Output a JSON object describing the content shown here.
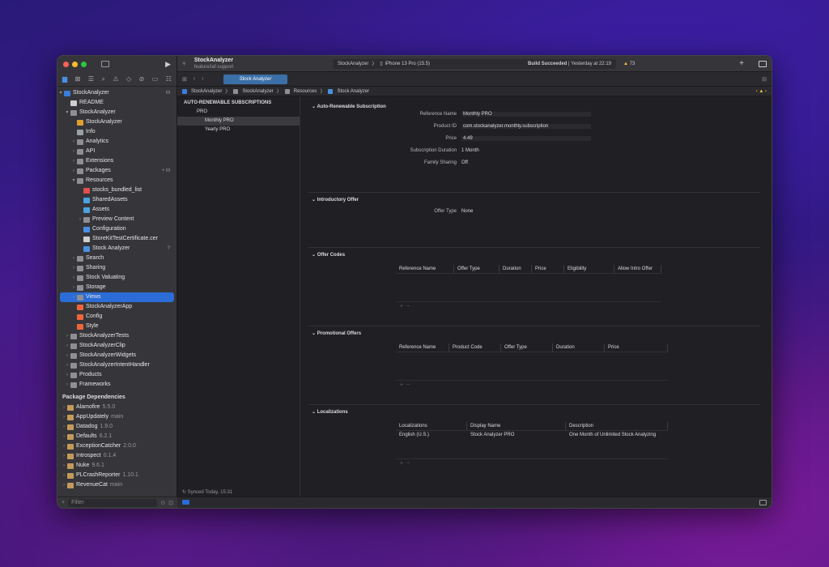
{
  "window": {
    "project_name": "StockAnalyzer",
    "branch": "feature/iaf-support",
    "scheme": "StockAnalyzer",
    "device": "iPhone 13 Pro (15.5)",
    "build_status": "Build Succeeded",
    "build_time": "Yesterday at 22:19",
    "warnings": "73"
  },
  "tab": {
    "label": "Stock Analyzer"
  },
  "pathbar": [
    "StockAnalyzer",
    "StockAnalyzer",
    "Resources",
    "Stock Analyzer"
  ],
  "sidebar": {
    "root": "StockAnalyzer",
    "root_badge": "M",
    "items": [
      {
        "label": "README",
        "depth": 1,
        "icon": "doc",
        "chev": ""
      },
      {
        "label": "StockAnalyzer",
        "depth": 1,
        "icon": "folder",
        "chev": "v"
      },
      {
        "label": "StockAnalyzer",
        "depth": 2,
        "icon": "entitlement",
        "chev": ""
      },
      {
        "label": "Info",
        "depth": 2,
        "icon": "plist",
        "chev": ""
      },
      {
        "label": "Analytics",
        "depth": 2,
        "icon": "folder",
        "chev": ">"
      },
      {
        "label": "API",
        "depth": 2,
        "icon": "folder",
        "chev": ">"
      },
      {
        "label": "Extensions",
        "depth": 2,
        "icon": "folder",
        "chev": ">"
      },
      {
        "label": "Packages",
        "depth": 2,
        "icon": "folder",
        "chev": ">",
        "badge": "+ M"
      },
      {
        "label": "Resources",
        "depth": 2,
        "icon": "folder",
        "chev": "v"
      },
      {
        "label": "stocks_bundled_list",
        "depth": 3,
        "icon": "json",
        "chev": ""
      },
      {
        "label": "SharedAssets",
        "depth": 3,
        "icon": "assets",
        "chev": ""
      },
      {
        "label": "Assets",
        "depth": 3,
        "icon": "assets",
        "chev": ""
      },
      {
        "label": "Preview Content",
        "depth": 3,
        "icon": "folder",
        "chev": ">"
      },
      {
        "label": "Configuration",
        "depth": 3,
        "icon": "storekit",
        "chev": ""
      },
      {
        "label": "StoreKitTestCertificate.cer",
        "depth": 3,
        "icon": "doc",
        "chev": ""
      },
      {
        "label": "Stock Analyzer",
        "depth": 3,
        "icon": "storekit",
        "chev": "",
        "badge": "?"
      },
      {
        "label": "Search",
        "depth": 2,
        "icon": "folder",
        "chev": ">"
      },
      {
        "label": "Sharing",
        "depth": 2,
        "icon": "folder",
        "chev": ">"
      },
      {
        "label": "Stock Valuating",
        "depth": 2,
        "icon": "folder",
        "chev": ">"
      },
      {
        "label": "Storage",
        "depth": 2,
        "icon": "folder",
        "chev": ">"
      },
      {
        "label": "Views",
        "depth": 2,
        "icon": "folder",
        "chev": ">",
        "selected": true
      },
      {
        "label": "StockAnalyzerApp",
        "depth": 2,
        "icon": "swift",
        "chev": ""
      },
      {
        "label": "Config",
        "depth": 2,
        "icon": "swift",
        "chev": ""
      },
      {
        "label": "Style",
        "depth": 2,
        "icon": "swift",
        "chev": ""
      },
      {
        "label": "StockAnalyzerTests",
        "depth": 1,
        "icon": "folder",
        "chev": ">"
      },
      {
        "label": "StockAnalyzerClip",
        "depth": 1,
        "icon": "folder",
        "chev": ">"
      },
      {
        "label": "StockAnalyzerWidgets",
        "depth": 1,
        "icon": "folder",
        "chev": ">"
      },
      {
        "label": "StockAnalyzerIntentHandler",
        "depth": 1,
        "icon": "folder",
        "chev": ">"
      },
      {
        "label": "Products",
        "depth": 1,
        "icon": "folder",
        "chev": ">"
      },
      {
        "label": "Frameworks",
        "depth": 1,
        "icon": "folder",
        "chev": ">"
      }
    ],
    "packages_heading": "Package Dependencies",
    "packages": [
      {
        "name": "Alamofire",
        "version": "5.5.0"
      },
      {
        "name": "AppUpdately",
        "version": "main"
      },
      {
        "name": "Datadog",
        "version": "1.9.0"
      },
      {
        "name": "Defaults",
        "version": "6.2.1"
      },
      {
        "name": "ExceptionCatcher",
        "version": "2.0.0"
      },
      {
        "name": "Introspect",
        "version": "0.1.4"
      },
      {
        "name": "Nuke",
        "version": "9.6.1"
      },
      {
        "name": "PLCrashReporter",
        "version": "1.10.1"
      },
      {
        "name": "RevenueCat",
        "version": "main"
      }
    ],
    "filter_placeholder": "Filter"
  },
  "subscriptions": {
    "heading": "AUTO-RENEWABLE SUBSCRIPTIONS",
    "group": "PRO",
    "items": [
      "Monthly PRO",
      "Yearly PRO"
    ],
    "synced": "Synced Today, 15:31"
  },
  "detail": {
    "auto_title": "Auto-Renewable Subscription",
    "fields": [
      {
        "key": "Reference Name",
        "value": "Monthly PRO"
      },
      {
        "key": "Product ID",
        "value": "com.stockanalyzer.monthly.subscription"
      },
      {
        "key": "Price",
        "value": "4.49"
      },
      {
        "key": "Subscription Duration",
        "value": "1 Month"
      },
      {
        "key": "Family Sharing",
        "value": "Off"
      }
    ],
    "intro_title": "Introductory Offer",
    "offer_type_key": "Offer Type",
    "offer_type_value": "None",
    "codes_title": "Offer Codes",
    "codes_columns": [
      "Reference Name",
      "Offer Type",
      "Duration",
      "Price",
      "Eligibility",
      "Allow Intro Offer"
    ],
    "promo_title": "Promotional Offers",
    "promo_columns": [
      "Reference Name",
      "Product Code",
      "Offer Type",
      "Duration",
      "Price"
    ],
    "loc_title": "Localizations",
    "loc_columns": [
      "Localizations",
      "Display Name",
      "Description"
    ],
    "loc_rows": [
      [
        "English (U.S.)",
        "Stock Analyzer PRO",
        "One Month of Unlimited Stock Analyzing"
      ]
    ]
  }
}
